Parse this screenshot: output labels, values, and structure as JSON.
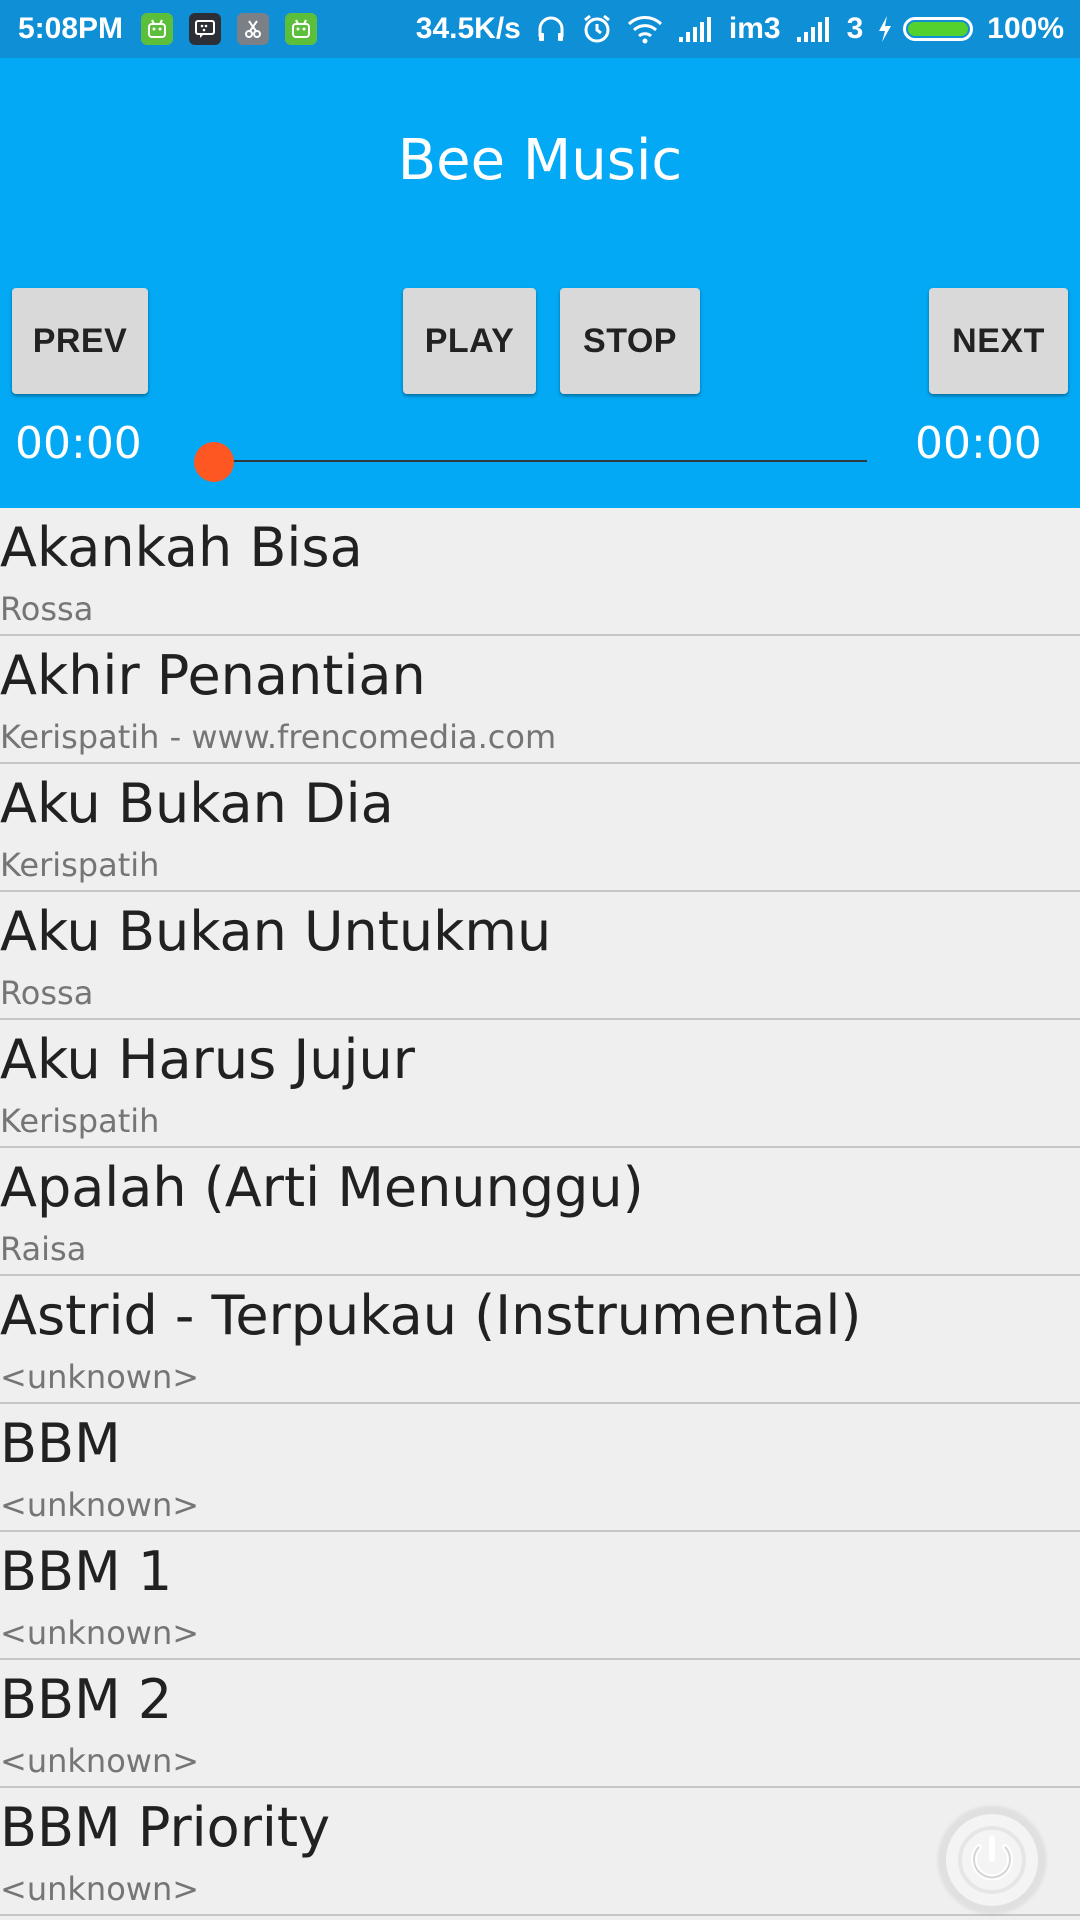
{
  "status_bar": {
    "time": "5:08PM",
    "net_speed": "34.5K/s",
    "carrier": "im3",
    "sim2_label": "3",
    "battery_percent": "100%",
    "battery_level": 1.0,
    "icons": [
      "android-icon",
      "bbm-icon",
      "scissor-icon",
      "android-icon",
      "headphones-icon",
      "alarm-icon",
      "wifi-icon",
      "signal-icon",
      "signal-icon",
      "charging-icon"
    ]
  },
  "header": {
    "title": "Bee Music",
    "background": "#03a9f4"
  },
  "controls": {
    "prev": "PREV",
    "play": "PLAY",
    "stop": "STOP",
    "next": "NEXT"
  },
  "seekbar": {
    "current_time": "00:00",
    "total_time": "00:00",
    "progress": 0,
    "thumb_color": "#ff5722"
  },
  "songs": [
    {
      "title": "Akankah Bisa",
      "artist": "Rossa"
    },
    {
      "title": "Akhir Penantian",
      "artist": "Kerispatih - www.frencomedia.com"
    },
    {
      "title": "Aku Bukan Dia",
      "artist": "Kerispatih"
    },
    {
      "title": "Aku Bukan Untukmu",
      "artist": "Rossa"
    },
    {
      "title": "Aku Harus Jujur",
      "artist": "Kerispatih"
    },
    {
      "title": "Apalah (Arti Menunggu)",
      "artist": "Raisa"
    },
    {
      "title": "Astrid - Terpukau (Instrumental)",
      "artist": "<unknown>"
    },
    {
      "title": "BBM",
      "artist": "<unknown>"
    },
    {
      "title": "BBM 1",
      "artist": "<unknown>"
    },
    {
      "title": "BBM 2",
      "artist": "<unknown>"
    },
    {
      "title": "BBM Priority",
      "artist": "<unknown>"
    }
  ],
  "floating_button": {
    "icon": "power-icon"
  }
}
